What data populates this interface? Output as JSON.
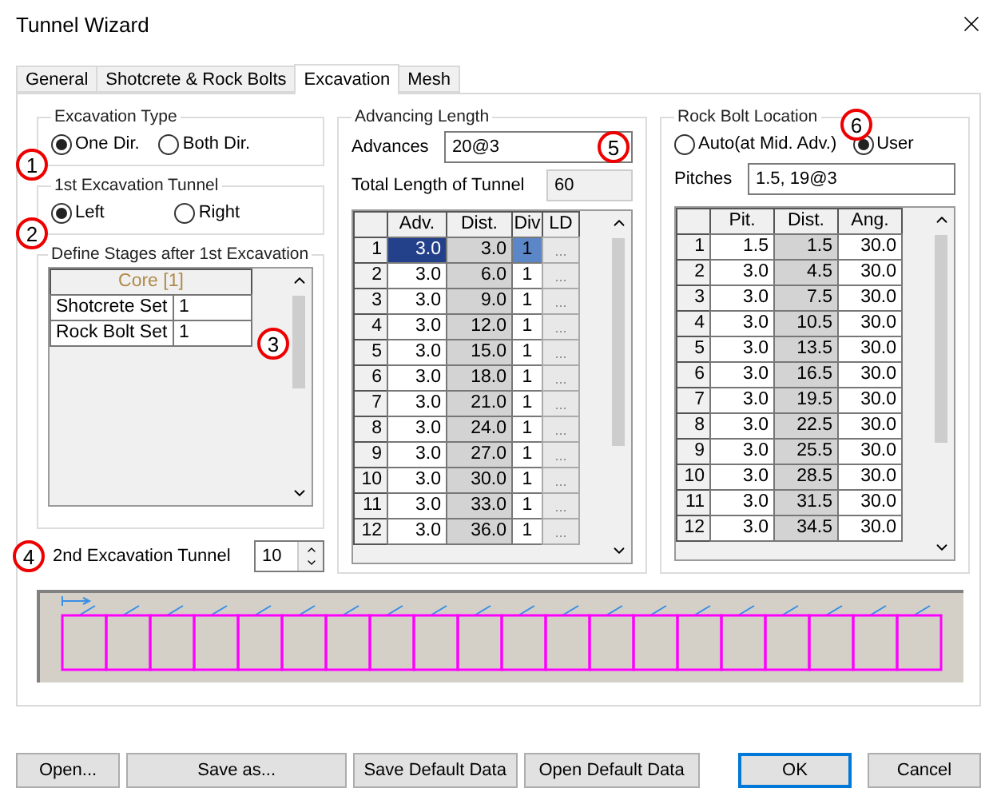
{
  "window": {
    "title": "Tunnel Wizard"
  },
  "tabs": [
    {
      "label": "General",
      "selected": false
    },
    {
      "label": "Shotcrete & Rock Bolts",
      "selected": false
    },
    {
      "label": "Excavation",
      "selected": true
    },
    {
      "label": "Mesh",
      "selected": false
    }
  ],
  "excavation_type": {
    "title": "Excavation Type",
    "marker": "1",
    "options": [
      {
        "label": "One Dir.",
        "selected": true
      },
      {
        "label": "Both Dir.",
        "selected": false
      }
    ]
  },
  "first_excavation_tunnel": {
    "title": "1st Excavation Tunnel",
    "marker": "2",
    "options": [
      {
        "label": "Left",
        "selected": true
      },
      {
        "label": "Right",
        "selected": false
      }
    ]
  },
  "define_stages": {
    "title": "Define Stages after 1st Excavation",
    "marker": "3",
    "header": "Core [1]",
    "rows": [
      {
        "label": "Shotcrete Set",
        "value": "1"
      },
      {
        "label": "Rock Bolt Set",
        "value": "1"
      }
    ]
  },
  "second_excavation_tunnel": {
    "marker": "4",
    "label": "2nd Excavation Tunnel",
    "value": "10"
  },
  "advancing_length": {
    "title": "Advancing Length",
    "marker": "5",
    "advances_label": "Advances",
    "advances": "20@3",
    "total_label": "Total Length of Tunnel",
    "total": "60",
    "columns": [
      "Adv.",
      "Dist.",
      "Div",
      "LD"
    ],
    "rows": [
      {
        "index": "1",
        "adv": "3.0",
        "dist": "3.0",
        "div": "1",
        "ldf": "...",
        "selected": true
      },
      {
        "index": "2",
        "adv": "3.0",
        "dist": "6.0",
        "div": "1",
        "ldf": "...",
        "selected": false
      },
      {
        "index": "3",
        "adv": "3.0",
        "dist": "9.0",
        "div": "1",
        "ldf": "...",
        "selected": false
      },
      {
        "index": "4",
        "adv": "3.0",
        "dist": "12.0",
        "div": "1",
        "ldf": "...",
        "selected": false
      },
      {
        "index": "5",
        "adv": "3.0",
        "dist": "15.0",
        "div": "1",
        "ldf": "...",
        "selected": false
      },
      {
        "index": "6",
        "adv": "3.0",
        "dist": "18.0",
        "div": "1",
        "ldf": "...",
        "selected": false
      },
      {
        "index": "7",
        "adv": "3.0",
        "dist": "21.0",
        "div": "1",
        "ldf": "...",
        "selected": false
      },
      {
        "index": "8",
        "adv": "3.0",
        "dist": "24.0",
        "div": "1",
        "ldf": "...",
        "selected": false
      },
      {
        "index": "9",
        "adv": "3.0",
        "dist": "27.0",
        "div": "1",
        "ldf": "...",
        "selected": false
      },
      {
        "index": "10",
        "adv": "3.0",
        "dist": "30.0",
        "div": "1",
        "ldf": "...",
        "selected": false
      },
      {
        "index": "11",
        "adv": "3.0",
        "dist": "33.0",
        "div": "1",
        "ldf": "...",
        "selected": false
      },
      {
        "index": "12",
        "adv": "3.0",
        "dist": "36.0",
        "div": "1",
        "ldf": "...",
        "selected": false
      }
    ]
  },
  "rock_bolt_location": {
    "title": "Rock Bolt Location",
    "marker": "6",
    "options": [
      {
        "label": "Auto(at Mid. Adv.)",
        "selected": false
      },
      {
        "label": "User",
        "selected": true
      }
    ],
    "pitches_label": "Pitches",
    "pitches": "1.5, 19@3",
    "columns": [
      "Pit.",
      "Dist.",
      "Ang."
    ],
    "rows": [
      {
        "index": "1",
        "pit": "1.5",
        "dist": "1.5",
        "ang": "30.0"
      },
      {
        "index": "2",
        "pit": "3.0",
        "dist": "4.5",
        "ang": "30.0"
      },
      {
        "index": "3",
        "pit": "3.0",
        "dist": "7.5",
        "ang": "30.0"
      },
      {
        "index": "4",
        "pit": "3.0",
        "dist": "10.5",
        "ang": "30.0"
      },
      {
        "index": "5",
        "pit": "3.0",
        "dist": "13.5",
        "ang": "30.0"
      },
      {
        "index": "6",
        "pit": "3.0",
        "dist": "16.5",
        "ang": "30.0"
      },
      {
        "index": "7",
        "pit": "3.0",
        "dist": "19.5",
        "ang": "30.0"
      },
      {
        "index": "8",
        "pit": "3.0",
        "dist": "22.5",
        "ang": "30.0"
      },
      {
        "index": "9",
        "pit": "3.0",
        "dist": "25.5",
        "ang": "30.0"
      },
      {
        "index": "10",
        "pit": "3.0",
        "dist": "28.5",
        "ang": "30.0"
      },
      {
        "index": "11",
        "pit": "3.0",
        "dist": "31.5",
        "ang": "30.0"
      },
      {
        "index": "12",
        "pit": "3.0",
        "dist": "34.5",
        "ang": "30.0"
      }
    ]
  },
  "buttons": [
    {
      "label": "Open...",
      "default": false
    },
    {
      "label": "Save as...",
      "default": false
    },
    {
      "label": "Save Default Data",
      "default": false
    },
    {
      "label": "Open Default Data",
      "default": false
    },
    {
      "label": "OK",
      "default": true
    },
    {
      "label": "Cancel",
      "default": false
    }
  ]
}
